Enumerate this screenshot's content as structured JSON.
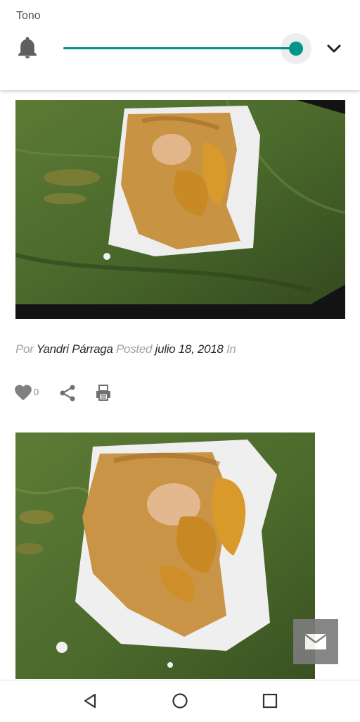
{
  "volume_panel": {
    "label": "Tono",
    "level_percent": 100,
    "icons": {
      "bell": "bell-icon",
      "expand": "chevron-down-icon"
    },
    "accent_color": "#009688"
  },
  "posts": [
    {
      "image": "food-photo",
      "by_prefix": "Por",
      "author": "Yandri Párraga",
      "posted_prefix": "Posted",
      "date": "julio 18, 2018",
      "in_prefix": "In",
      "likes": "0",
      "icons": [
        "heart-icon",
        "share-icon",
        "print-icon"
      ]
    },
    {
      "image": "food-photo"
    }
  ],
  "floating": {
    "icon": "mail-icon"
  },
  "nav_bar": {
    "icons": [
      "back-icon",
      "home-icon",
      "recents-icon"
    ]
  }
}
